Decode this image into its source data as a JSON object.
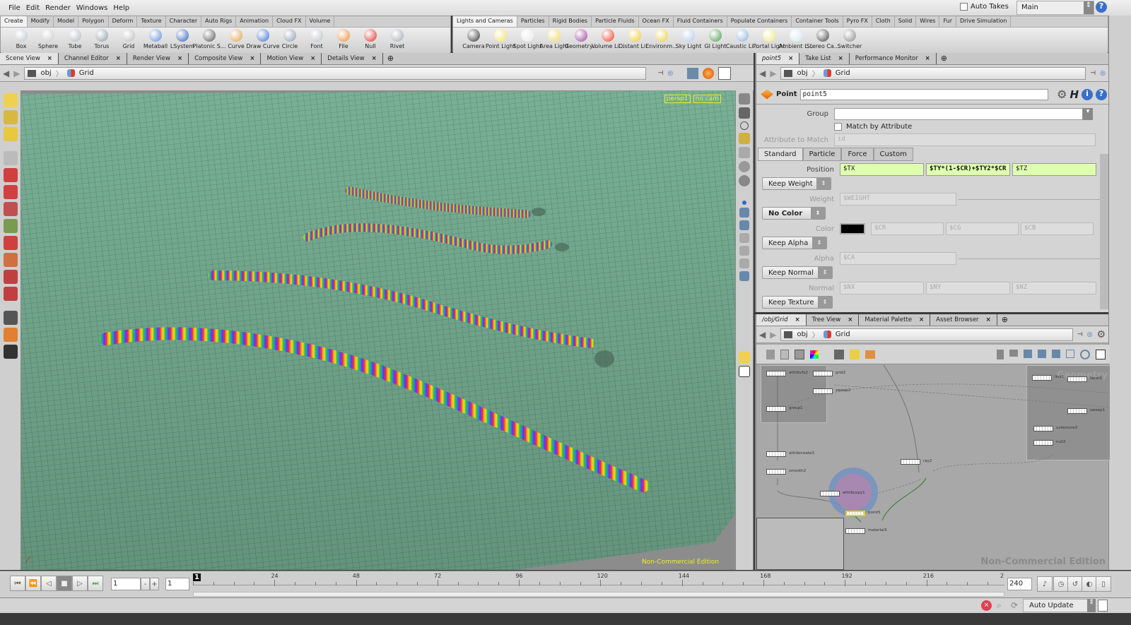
{
  "menu": [
    "File",
    "Edit",
    "Render",
    "Windows",
    "Help"
  ],
  "top_right": {
    "auto_takes": "Auto Takes",
    "desktop": "Main"
  },
  "shelf_left": {
    "tabs": [
      "Create",
      "Modify",
      "Model",
      "Polygon",
      "Deform",
      "Texture",
      "Character",
      "Auto Rigs",
      "Animation",
      "Cloud FX",
      "Volume"
    ],
    "tools": [
      {
        "label": "Box",
        "color": "#b8c4cc"
      },
      {
        "label": "Sphere",
        "color": "#c8c8c8"
      },
      {
        "label": "Tube",
        "color": "#b0b8c0"
      },
      {
        "label": "Torus",
        "color": "#8a9aa8"
      },
      {
        "label": "Grid",
        "color": "#bbbbbb"
      },
      {
        "label": "Metaball",
        "color": "#5a8ed8"
      },
      {
        "label": "LSystem",
        "color": "#2a5fb8"
      },
      {
        "label": "Platonic S...",
        "color": "#555555"
      },
      {
        "label": "Curve",
        "color": "#e0a040"
      },
      {
        "label": "Draw Curve",
        "color": "#3a70d0"
      },
      {
        "label": "Circle",
        "color": "#8a9ab0"
      },
      {
        "label": "Font",
        "color": "#b8c0c8"
      },
      {
        "label": "File",
        "color": "#f08a30"
      },
      {
        "label": "Null",
        "color": "#e03030"
      },
      {
        "label": "Rivet",
        "color": "#a0a8b0"
      }
    ]
  },
  "shelf_right": {
    "tabs": [
      "Lights and Cameras",
      "Particles",
      "Rigid Bodies",
      "Particle Fluids",
      "Ocean FX",
      "Fluid Containers",
      "Populate Containers",
      "Container Tools",
      "Pyro FX",
      "Cloth",
      "Solid",
      "Wires",
      "Fur",
      "Drive Simulation"
    ],
    "tools": [
      {
        "label": "Camera",
        "color": "#333333"
      },
      {
        "label": "Point Light",
        "color": "#f0e060"
      },
      {
        "label": "Spot Light",
        "color": "#e8e8e8"
      },
      {
        "label": "Area Light",
        "color": "#f0d860"
      },
      {
        "label": "Geometry...",
        "color": "#9a40a0"
      },
      {
        "label": "Volume Li...",
        "color": "#e84020"
      },
      {
        "label": "Distant Li...",
        "color": "#f0c830"
      },
      {
        "label": "Environm...",
        "color": "#e8d040"
      },
      {
        "label": "Sky Light",
        "color": "#b0c8f0"
      },
      {
        "label": "GI Light",
        "color": "#4a9a4a"
      },
      {
        "label": "Caustic Li...",
        "color": "#8ab0e0"
      },
      {
        "label": "Portal Light",
        "color": "#f0e880"
      },
      {
        "label": "Ambient L...",
        "color": "#d0e8f0"
      },
      {
        "label": "Stereo Ca...",
        "color": "#444444"
      },
      {
        "label": "Switcher",
        "color": "#888888"
      }
    ]
  },
  "scene": {
    "tabs": [
      "Scene View",
      "Channel Editor",
      "Render View",
      "Composite View",
      "Motion View",
      "Details View"
    ],
    "path": [
      "obj",
      "Grid"
    ],
    "camera": "persp1",
    "cam_menu": "no cam",
    "watermark": "Non-Commercial Edition"
  },
  "params": {
    "tabs": [
      "point5",
      "Take List",
      "Performance Monitor"
    ],
    "path": [
      "obj",
      "Grid"
    ],
    "node_type": "Point",
    "node_name": "point5",
    "group_label": "Group",
    "group_value": "",
    "match_by_attribute": "Match by Attribute",
    "attr_match_label": "Attribute to Match",
    "attr_match_value": "id",
    "subtabs": [
      "Standard",
      "Particle",
      "Force",
      "Custom"
    ],
    "position_label": "Position",
    "position": [
      "$TX",
      "$TY*(1-$CR)+$TY2*$CR",
      "$TZ"
    ],
    "weight_menu": "Keep Weight",
    "weight_label": "Weight",
    "weight_value": "$WEIGHT",
    "color_menu": "No Color",
    "color_label": "Color",
    "color_swatch": "#000000",
    "color_values": [
      "$CR",
      "$CG",
      "$CB"
    ],
    "alpha_menu": "Keep Alpha",
    "alpha_label": "Alpha",
    "alpha_value": "$CA",
    "normal_menu": "Keep Normal",
    "normal_label": "Normal",
    "normal_values": [
      "$NX",
      "$NY",
      "$NZ"
    ],
    "texture_menu": "Keep Texture"
  },
  "network": {
    "tabs": [
      "/obj/Grid",
      "Tree View",
      "Material Palette",
      "Asset Browser"
    ],
    "path": [
      "obj",
      "Grid"
    ],
    "box_label": "Geometry",
    "watermark": "Non-Commercial Edition",
    "nodes": [
      "attribvfx2",
      "grid2",
      "sweep2",
      "group1",
      "attribcreate3",
      "smooth2",
      "attribcopy1",
      "ray2",
      "point5",
      "material3",
      "line1",
      "facet1",
      "sweep1",
      "uvtexture3",
      "null2"
    ]
  },
  "timeline": {
    "frame": "1",
    "start": "1",
    "end": "240",
    "current_marker": "1",
    "ticks": [
      "24",
      "48",
      "72",
      "96",
      "120",
      "144",
      "168",
      "192",
      "216",
      "2"
    ]
  },
  "status": {
    "update_mode": "Auto Update"
  }
}
